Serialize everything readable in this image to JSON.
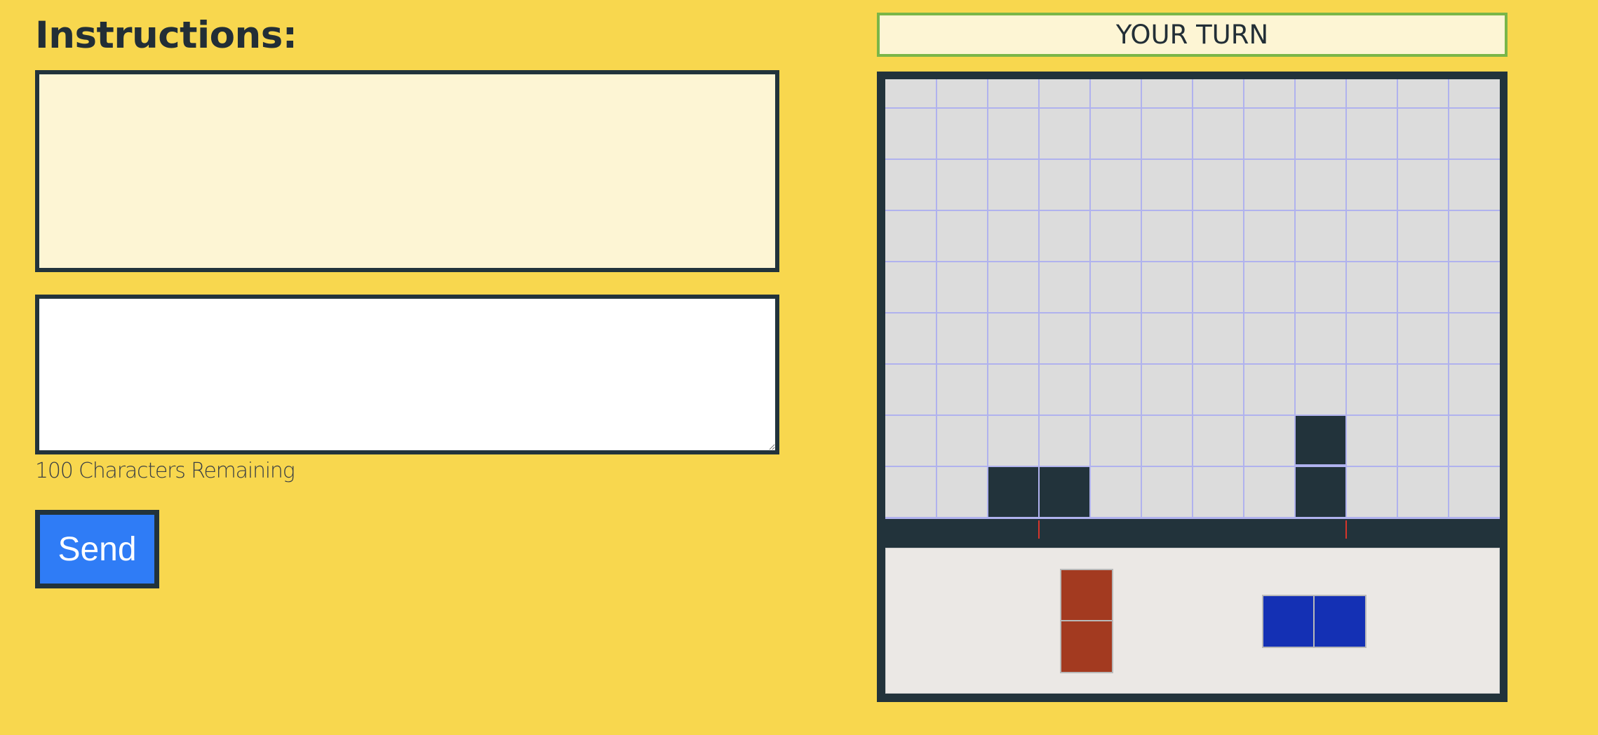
{
  "instructions": {
    "heading": "Instructions:",
    "text": ""
  },
  "message": {
    "value": "",
    "placeholder": "",
    "chars_remaining_label": "100 Characters Remaining"
  },
  "send_button": {
    "label": "Send"
  },
  "turn_banner": {
    "label": "YOUR TURN"
  },
  "board": {
    "columns": 12,
    "rows": 9,
    "filled_cells": [
      {
        "col": 2,
        "row": 8
      },
      {
        "col": 3,
        "row": 8
      },
      {
        "col": 8,
        "row": 7
      },
      {
        "col": 8,
        "row": 8
      }
    ],
    "drop_marker_columns": [
      3,
      9
    ]
  },
  "tray": {
    "pieces": [
      {
        "name": "red-vertical-domino",
        "color": "#a33a20",
        "orientation": "vertical",
        "cells": 2
      },
      {
        "name": "blue-horizontal-domino",
        "color": "#1430b4",
        "orientation": "horizontal",
        "cells": 2
      }
    ]
  },
  "colors": {
    "background": "#f8d74e",
    "frame": "#22333b",
    "grid_line": "#b0b2ee",
    "board_background": "#dcdcdc",
    "filled_cell": "#22333b",
    "drop_marker": "#d7352b",
    "send_button": "#2f7cf6",
    "turn_border": "#7ab648"
  }
}
